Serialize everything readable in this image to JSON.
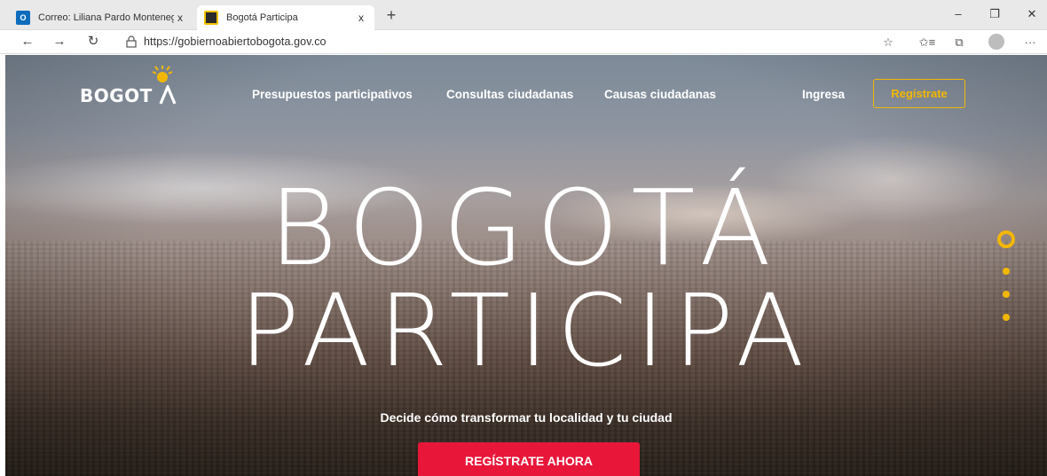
{
  "browser": {
    "tabs": [
      {
        "title": "Correo: Liliana Pardo Montenegr",
        "icon": "outlook-icon",
        "close": "x"
      },
      {
        "title": "Bogotá Participa",
        "icon": "bogota-participa-icon",
        "close": "x"
      }
    ],
    "new_tab": "+",
    "window_controls": {
      "minimize": "–",
      "restore": "❐",
      "close": "✕"
    },
    "nav": {
      "back": "←",
      "forward": "→",
      "refresh": "↻"
    },
    "url": "https://gobiernoabiertobogota.gov.co",
    "toolbar": {
      "favorite": "☆",
      "favorites": "✩≡",
      "collections": "⧉",
      "more": "···"
    }
  },
  "site": {
    "logo": "BOGOT",
    "nav_links": [
      "Presupuestos participativos",
      "Consultas ciudadanas",
      "Causas ciudadanas"
    ],
    "login": "Ingresa",
    "register": "Regístrate",
    "hero_line1": "BOGOTÁ",
    "hero_line2": "PARTICIPA",
    "tagline": "Decide cómo transformar tu localidad y tu ciudad",
    "cta": "REGÍSTRATE AHORA",
    "slider": {
      "active_index": 0,
      "count": 4
    },
    "colors": {
      "accent": "#f2b705",
      "cta": "#e8173a"
    }
  }
}
